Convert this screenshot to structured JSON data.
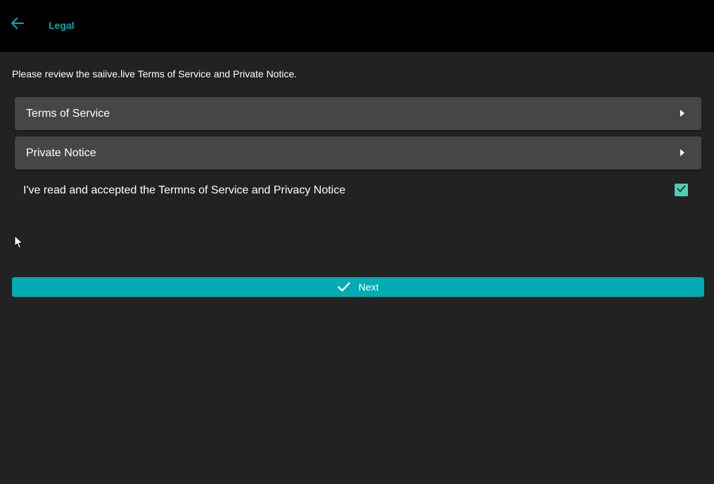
{
  "colors": {
    "accent": "#00acb1",
    "checkbox": "#4ecdb6",
    "background": "#222222",
    "topbar": "#000000",
    "card": "#464646"
  },
  "header": {
    "back_icon": "arrow-left-icon",
    "title": "Legal"
  },
  "intro": "Please review the saiive.live Terms of Service and Private Notice.",
  "sections": [
    {
      "label": "Terms of Service",
      "icon": "chevron-right-icon"
    },
    {
      "label": "Private Notice",
      "icon": "chevron-right-icon"
    }
  ],
  "accept": {
    "label": "I've read and accepted the Termns of Service and Privacy Notice",
    "checked": true
  },
  "next_button": {
    "label": "Next",
    "icon": "check-icon"
  }
}
